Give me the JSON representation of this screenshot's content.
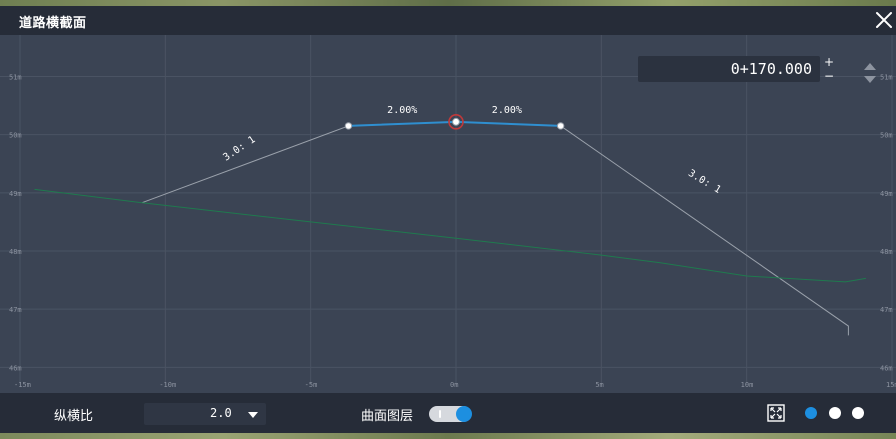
{
  "window": {
    "title": "道路横截面"
  },
  "station": {
    "value": "0+170.000",
    "plus_label": "+",
    "minus_label": "−"
  },
  "controls": {
    "ratio_label": "纵横比",
    "ratio_value": "2.0",
    "surface_layer_label": "曲面图层",
    "surface_layer_on": true
  },
  "theme_dots": [
    {
      "color": "#1d8fe0",
      "selected": true
    },
    {
      "color": "#ffffff",
      "selected": false
    },
    {
      "color": "#ffffff",
      "selected": false
    }
  ],
  "chart_data": {
    "type": "line",
    "x_tick_labels": [
      "-15m",
      "-10m",
      "-5m",
      "0m",
      "5m",
      "10m",
      "15m"
    ],
    "y_tick_labels": [
      "51m",
      "50m",
      "49m",
      "48m",
      "47m",
      "46m"
    ],
    "xlim": [
      -15,
      15
    ],
    "ylim": [
      45.8,
      51.3
    ],
    "grid": true,
    "series": [
      {
        "role": "road",
        "color": "#2f8fd0",
        "points": [
          [
            -3.7,
            50.15
          ],
          [
            0,
            50.22
          ],
          [
            3.6,
            50.15
          ]
        ]
      },
      {
        "role": "slope-left",
        "color": "#9aa1ab",
        "points": [
          [
            -10.8,
            48.83
          ],
          [
            -3.7,
            50.15
          ]
        ]
      },
      {
        "role": "slope-right",
        "color": "#9aa1ab",
        "points": [
          [
            3.6,
            50.15
          ],
          [
            13.5,
            46.71
          ],
          [
            13.5,
            46.55
          ]
        ]
      },
      {
        "role": "ground",
        "color": "#1f7a4e",
        "points": [
          [
            -14.5,
            49.06
          ],
          [
            -10.8,
            48.83
          ],
          [
            -5,
            48.5
          ],
          [
            0,
            48.22
          ],
          [
            5,
            47.93
          ],
          [
            7,
            47.8
          ],
          [
            10,
            47.57
          ],
          [
            13.4,
            47.47
          ],
          [
            14.1,
            47.53
          ]
        ]
      }
    ],
    "vertices": [
      [
        -3.7,
        50.15
      ],
      [
        3.6,
        50.15
      ]
    ],
    "center_point": [
      0,
      50.22
    ],
    "annotations": [
      {
        "text": "2.00%",
        "x": -1.85,
        "y": 50.37,
        "angle": 0
      },
      {
        "text": "2.00%",
        "x": 1.75,
        "y": 50.37,
        "angle": 0
      },
      {
        "text": "3.0: 1",
        "x": -7.4,
        "y": 49.72,
        "angle": -34
      },
      {
        "text": "3.0: 1",
        "x": 8.5,
        "y": 49.15,
        "angle": 31
      }
    ]
  }
}
